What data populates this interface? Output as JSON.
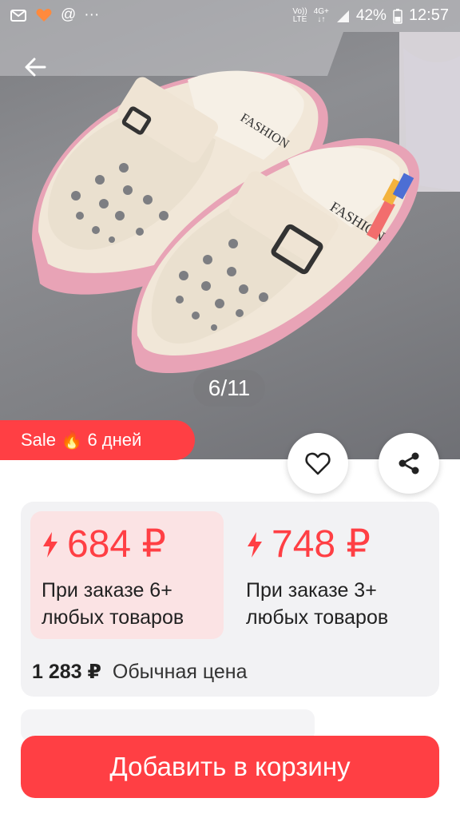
{
  "status_bar": {
    "network_top": "Vo))",
    "network_bottom": "LTE",
    "signal_top": "4G+",
    "battery": "42%",
    "time": "12:57"
  },
  "gallery": {
    "counter": "6/11",
    "shoe_brand_text": "FASHION"
  },
  "sale": {
    "label": "Sale",
    "emoji": "🔥",
    "duration": "6 дней"
  },
  "prices": {
    "tiers": [
      {
        "price": "684 ₽",
        "condition_line1": "При заказе 6+",
        "condition_line2": "любых товаров"
      },
      {
        "price": "748 ₽",
        "condition_line1": "При заказе 3+",
        "condition_line2": "любых товаров"
      }
    ],
    "regular_price": "1 283 ₽",
    "regular_label": "Обычная цена"
  },
  "actions": {
    "add_to_cart": "Добавить в корзину"
  },
  "colors": {
    "accent": "#ff3f44",
    "tier_highlight": "#fbe3e4",
    "card_bg": "#f2f2f4"
  }
}
